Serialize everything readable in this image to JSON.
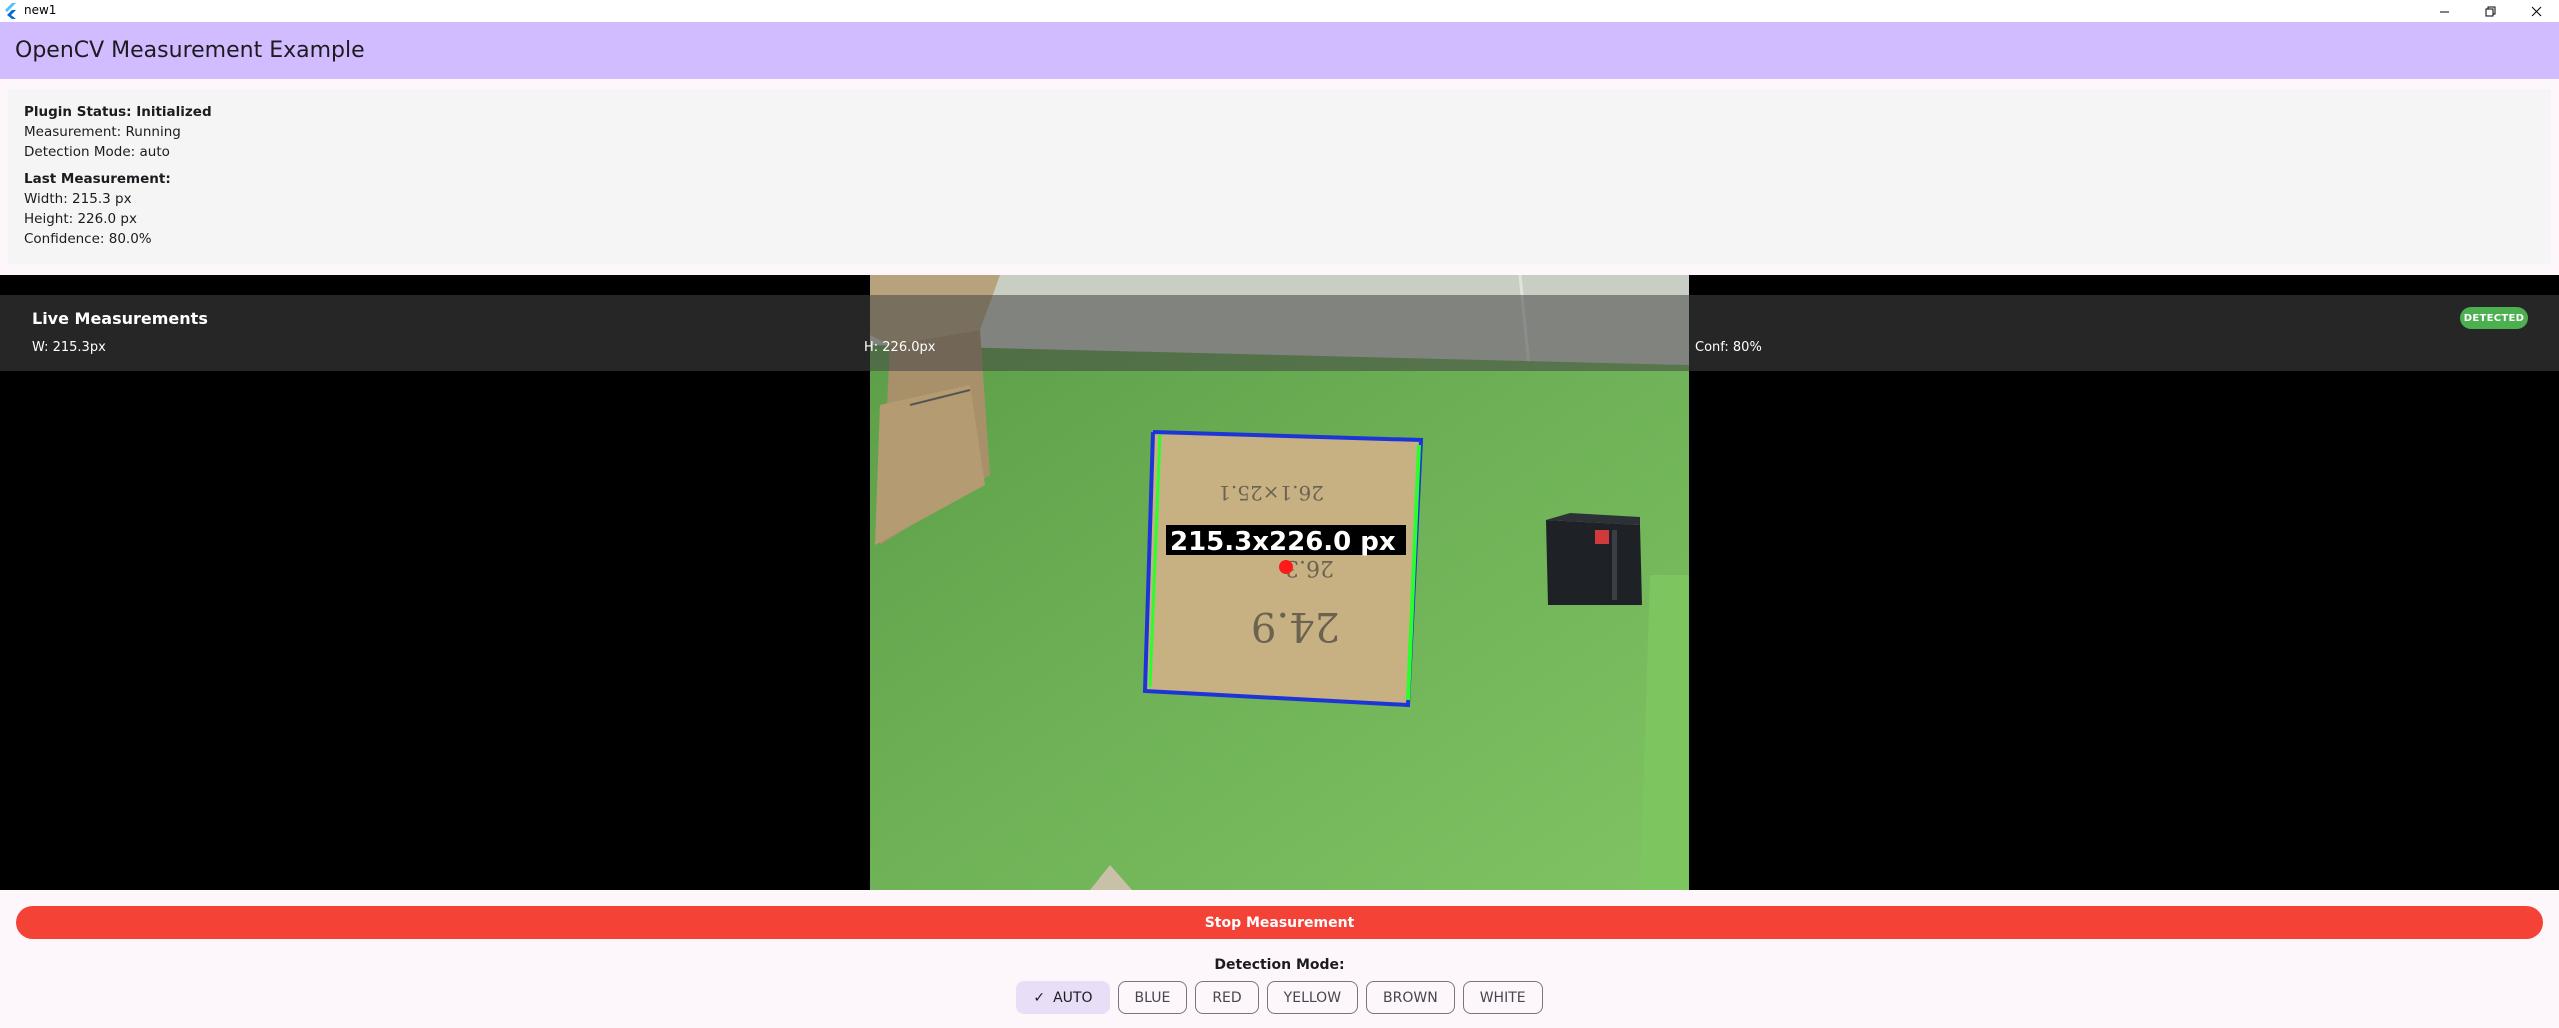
{
  "window": {
    "title": "new1"
  },
  "appbar": {
    "title": "OpenCV Measurement Example"
  },
  "status": {
    "plugin_status": "Plugin Status: Initialized",
    "measurement": "Measurement: Running",
    "detection_mode": "Detection Mode: auto",
    "last_heading": "Last Measurement:",
    "width": "Width: 215.3 px",
    "height": "Height: 226.0 px",
    "confidence": "Confidence: 80.0%"
  },
  "live": {
    "title": "Live Measurements",
    "width": "W: 215.3px",
    "height": "H: 226.0px",
    "confidence": "Conf: 80%",
    "badge": "DETECTED"
  },
  "camera": {
    "measurement_label": "215.3x226.0 px",
    "handwriting_top": "26.1×25.1",
    "handwriting_mid": "26.3",
    "handwriting_bottom": "24.9"
  },
  "controls": {
    "stop_label": "Stop Measurement",
    "mode_label": "Detection Mode:",
    "modes": [
      "AUTO",
      "BLUE",
      "RED",
      "YELLOW",
      "BROWN",
      "WHITE"
    ],
    "selected_mode": "AUTO"
  },
  "colors": {
    "appbar": "#d0bcfe",
    "status_ok": "#4caf50",
    "stop_button": "#f44336",
    "selected_chip": "#e8def8",
    "detected_badge": "#4caf50"
  }
}
